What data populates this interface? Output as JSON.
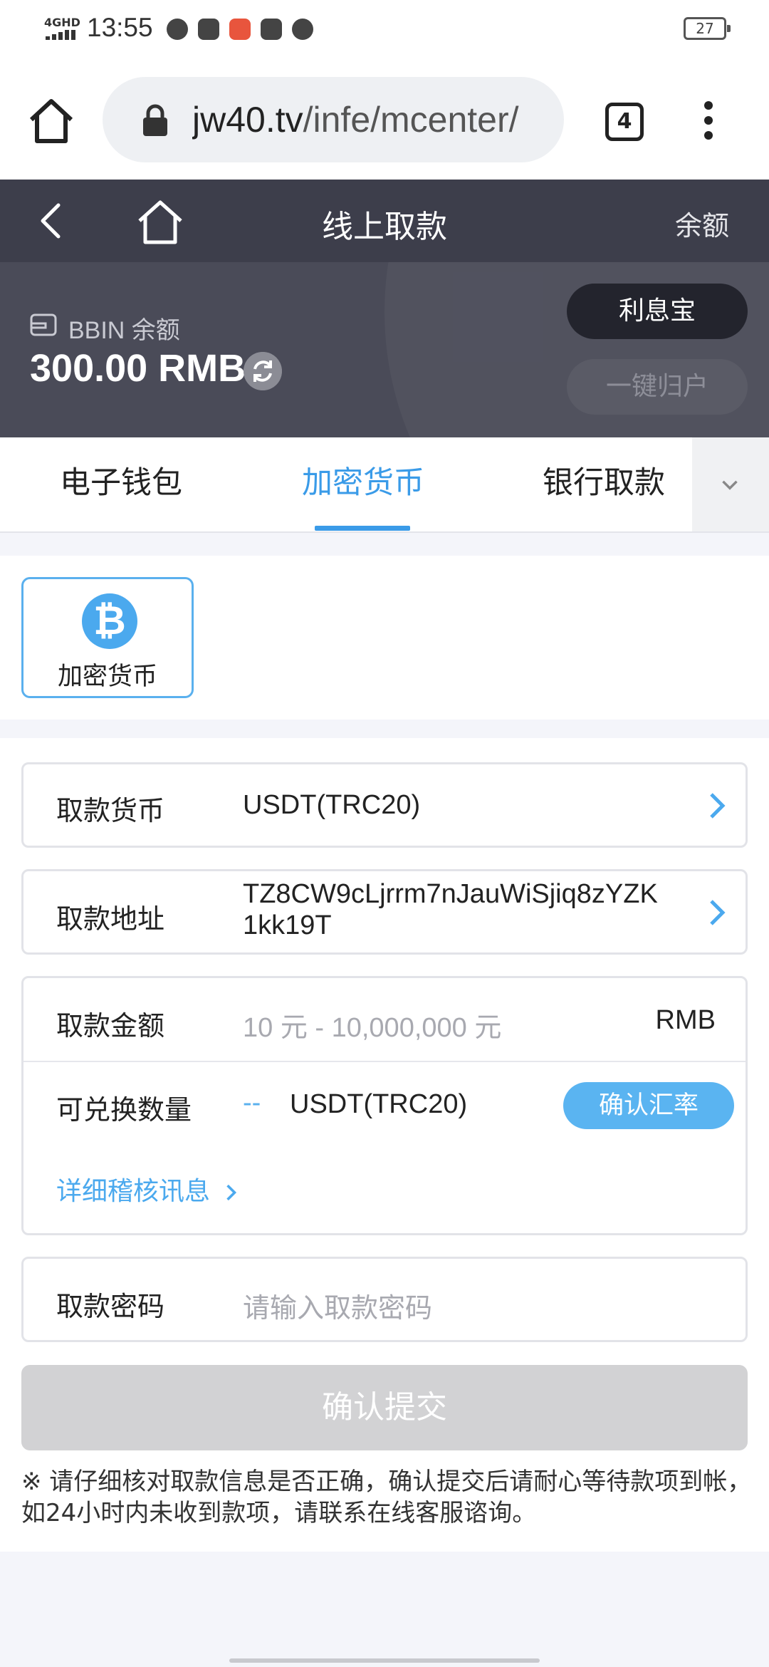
{
  "status_bar": {
    "network": "4GHD",
    "time": "13:55",
    "battery": "27"
  },
  "browser": {
    "url_domain": "jw40.tv",
    "url_path": "/infe/mcenter/",
    "tab_count": "4"
  },
  "header": {
    "title": "线上取款",
    "balance_link": "余额"
  },
  "balance": {
    "label": "BBIN 余额",
    "amount": "300.00 RMB",
    "interest_button": "利息宝",
    "collect_button": "一键归户"
  },
  "tabs": [
    {
      "label": "电子钱包",
      "active": false
    },
    {
      "label": "加密货币",
      "active": true
    },
    {
      "label": "银行取款",
      "active": false
    }
  ],
  "method": {
    "label": "加密货币",
    "icon": "bitcoin-icon"
  },
  "form": {
    "currency": {
      "label": "取款货币",
      "value": "USDT(TRC20)"
    },
    "address": {
      "label": "取款地址",
      "value_line1": "TZ8CW9cLjrrm7nJauWiSjiq8zYZK",
      "value_line2": "1kk19T"
    },
    "amount": {
      "label": "取款金额",
      "placeholder": "10 元 - 10,000,000 元",
      "unit": "RMB"
    },
    "convert": {
      "label": "可兑换数量",
      "value": "--",
      "unit": "USDT(TRC20)",
      "button": "确认汇率"
    },
    "detail_link": "详细稽核讯息",
    "password": {
      "label": "取款密码",
      "placeholder": "请输入取款密码"
    },
    "submit": "确认提交",
    "notice": "※ 请仔细核对取款信息是否正确，确认提交后请耐心等待款项到帐，如24小时内未收到款项，请联系在线客服谘询。"
  },
  "colors": {
    "accent": "#3a9be8",
    "header_bg": "#3d3e4b",
    "panel_bg": "#4a4b58",
    "submit_disabled": "#d2d2d4"
  }
}
